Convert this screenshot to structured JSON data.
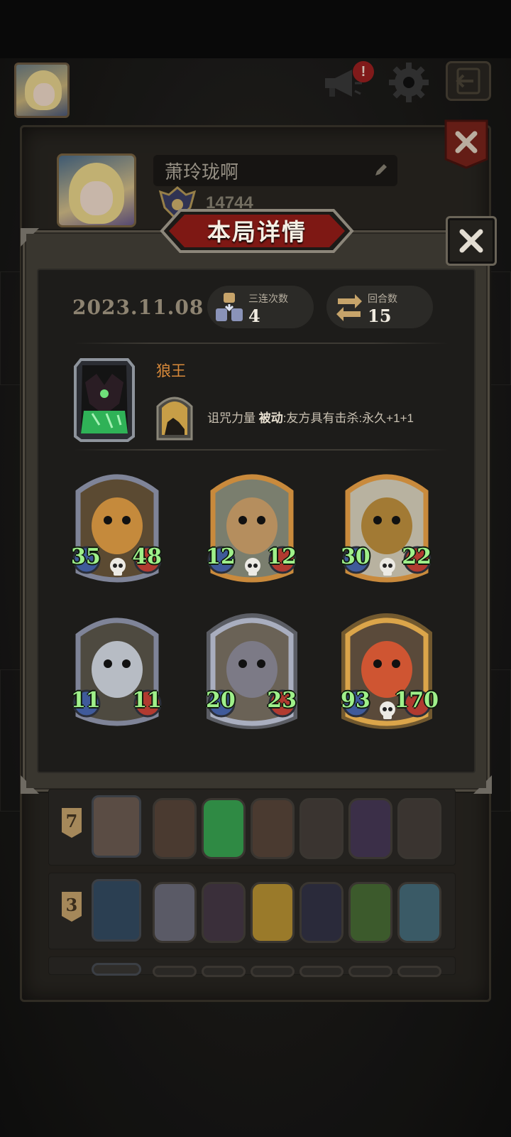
{
  "top_bar": {
    "avatar_icon": "player-portrait-blonde",
    "announcement_icon": "megaphone-icon",
    "notification_badge": "!",
    "settings_icon": "gear-icon",
    "exit_icon": "exit-arrow-icon"
  },
  "profile": {
    "player_name": "萧玲珑啊",
    "score": "14744"
  },
  "modal": {
    "title": "本局详情",
    "date": "2023.11.08",
    "stats": [
      {
        "label": "三连次数",
        "value": "4",
        "icon": "triple-stack-icon"
      },
      {
        "label": "回合数",
        "value": "15",
        "icon": "cycle-arrows-icon"
      }
    ],
    "hero": {
      "name": "狼王",
      "skill_name": "诅咒力量",
      "skill_type": "被动",
      "skill_desc": ":友方具有击杀:永久+1+1"
    },
    "units": [
      {
        "attack": "35",
        "health": "48",
        "frame": "silver",
        "portrait": "bear-knight",
        "skull": true
      },
      {
        "attack": "12",
        "health": "12",
        "frame": "gold",
        "portrait": "airship",
        "skull": true
      },
      {
        "attack": "30",
        "health": "22",
        "frame": "gold",
        "portrait": "steampunk-tank",
        "skull": true
      },
      {
        "attack": "11",
        "health": "11",
        "frame": "silver",
        "portrait": "tin-robot",
        "skull": false
      },
      {
        "attack": "20",
        "health": "23",
        "frame": "silver-glow",
        "portrait": "rat-bandit",
        "skull": false
      },
      {
        "attack": "93",
        "health": "170",
        "frame": "gold-glow",
        "portrait": "red-mech",
        "skull": true
      }
    ]
  },
  "history": [
    {
      "rank": "7",
      "hero": "plague-doctor",
      "units": [
        "ghoul",
        "green-beast",
        "ghoul",
        "dark-knight",
        "shadow-mage",
        "dark-knight"
      ]
    },
    {
      "rank": "3",
      "hero": "blue-bat",
      "units": [
        "white-dragon",
        "crow-priest",
        "sun-queen",
        "hooded-lady",
        "witch",
        "blue-rabbit"
      ]
    },
    {
      "rank": "",
      "hero": "",
      "units": [
        "",
        "",
        "",
        "",
        "",
        ""
      ]
    }
  ],
  "colors": {
    "accent_gold": "#d98a3a",
    "stat_green": "#9ff08a",
    "ribbon_red": "#8c1a16",
    "panel_dark": "#1d1c1a"
  }
}
